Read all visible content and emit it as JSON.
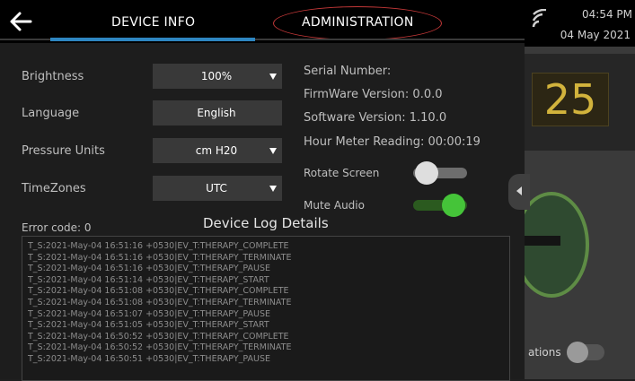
{
  "header": {
    "back_icon": "arrow-left-icon",
    "tabs": [
      {
        "label": "DEVICE INFO",
        "active": true
      },
      {
        "label": "ADMINISTRATION",
        "active": false
      }
    ],
    "accent_color": "#2e86c1",
    "highlight_color": "#c43838"
  },
  "settings": [
    {
      "label": "Brightness",
      "value": "100%",
      "dropdown": true
    },
    {
      "label": "Language",
      "value": "English",
      "dropdown": false
    },
    {
      "label": "Pressure Units",
      "value": "cm H20",
      "dropdown": true
    },
    {
      "label": "TimeZones",
      "value": "UTC",
      "dropdown": true
    }
  ],
  "info": {
    "serial": "Serial Number:",
    "firmware": "FirmWare Version: 0.0.0",
    "software": "Software Version:  1.10.0",
    "hour_meter": "Hour Meter Reading:  00:00:19"
  },
  "toggles": {
    "rotate": {
      "label": "Rotate Screen",
      "on": false
    },
    "mute": {
      "label": "Mute Audio",
      "on": true,
      "color": "#45c439"
    }
  },
  "log": {
    "error_code": "Error code: 0",
    "title": "Device Log Details",
    "entries": [
      "T_S:2021-May-04 16:51:16 +0530|EV_T:THERAPY_COMPLETE",
      "T_S:2021-May-04 16:51:16 +0530|EV_T:THERAPY_TERMINATE",
      "T_S:2021-May-04 16:51:16 +0530|EV_T:THERAPY_PAUSE",
      "T_S:2021-May-04 16:51:14 +0530|EV_T:THERAPY_START",
      "T_S:2021-May-04 16:51:08 +0530|EV_T:THERAPY_COMPLETE",
      "T_S:2021-May-04 16:51:08 +0530|EV_T:THERAPY_TERMINATE",
      "T_S:2021-May-04 16:51:07 +0530|EV_T:THERAPY_PAUSE",
      "T_S:2021-May-04 16:51:05 +0530|EV_T:THERAPY_START",
      "T_S:2021-May-04 16:50:52 +0530|EV_T:THERAPY_COMPLETE",
      "T_S:2021-May-04 16:50:52 +0530|EV_T:THERAPY_TERMINATE",
      "T_S:2021-May-04 16:50:51 +0530|EV_T:THERAPY_PAUSE"
    ]
  },
  "background": {
    "time": "04:54 PM",
    "date": "04 May 2021",
    "big_number": "25",
    "big_number_color": "#d2b33c",
    "bottom_label": "ations",
    "wifi_icon": "wifi-icon"
  }
}
